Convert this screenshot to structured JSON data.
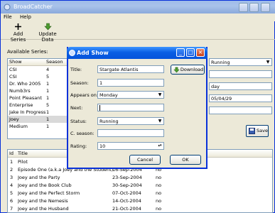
{
  "main_window": {
    "title": "BroadCatcher",
    "menu": [
      "File",
      "Help"
    ],
    "toolbar": {
      "add_series": "Add Series",
      "update_data": "Update Data"
    }
  },
  "series_panel": {
    "label": "Available Series:",
    "columns": [
      "Show",
      "Season"
    ],
    "rows": [
      {
        "show": "CSI",
        "season": "4"
      },
      {
        "show": "CSI",
        "season": "5"
      },
      {
        "show": "Dr. Who 2005",
        "season": "1"
      },
      {
        "show": "Numb3rs",
        "season": "1"
      },
      {
        "show": "Point Pleasant",
        "season": "1"
      },
      {
        "show": "Enterprise",
        "season": "5"
      },
      {
        "show": "Jake In Progress",
        "season": "1"
      },
      {
        "show": "Joey",
        "season": "1"
      },
      {
        "show": "Medium",
        "season": "1"
      }
    ]
  },
  "details_panel": {
    "status_value": "Running",
    "day_value": "day",
    "date_value": "05/04/29",
    "save_button": "Save"
  },
  "episodes": {
    "columns": [
      "Id",
      "Title"
    ],
    "rows": [
      {
        "id": "1",
        "title": "Pilot",
        "date": "",
        "flag": "no"
      },
      {
        "id": "2",
        "title": "Episode One (a.k.a Joey and the Student)",
        "date": "16-Sep-2004",
        "flag": "no"
      },
      {
        "id": "3",
        "title": "Joey and the Party",
        "date": "23-Sep-2004",
        "flag": "no"
      },
      {
        "id": "4",
        "title": "Joey and the Book Club",
        "date": "30-Sep-2004",
        "flag": "no"
      },
      {
        "id": "5",
        "title": "Joey and the Perfect Storm",
        "date": "07-Oct-2004",
        "flag": "no"
      },
      {
        "id": "6",
        "title": "Joey and the Nemesis",
        "date": "14-Oct-2004",
        "flag": "no"
      },
      {
        "id": "7",
        "title": "Joey and the Husband",
        "date": "21-Oct-2004",
        "flag": "no"
      }
    ]
  },
  "dialog": {
    "title": "Add Show",
    "title_label": "Title:",
    "title_value": "Stargate Atlantis",
    "download_button": "Download",
    "season_label": "Season:",
    "season_value": "1",
    "appears_label": "Appears on:",
    "appears_value": "Monday",
    "next_label": "Next:",
    "next_value": "",
    "status_label": "Status:",
    "status_value": "Running",
    "cseason_label": "C. season:",
    "cseason_value": "",
    "rating_label": "Rating:",
    "rating_value": "10",
    "cancel_button": "Cancel",
    "ok_button": "OK"
  },
  "colors": {
    "dialog_titlebar": "#0a5fe4",
    "main_titlebar_inactive": "#9ebbe9",
    "window_bg": "#ece9d8"
  }
}
